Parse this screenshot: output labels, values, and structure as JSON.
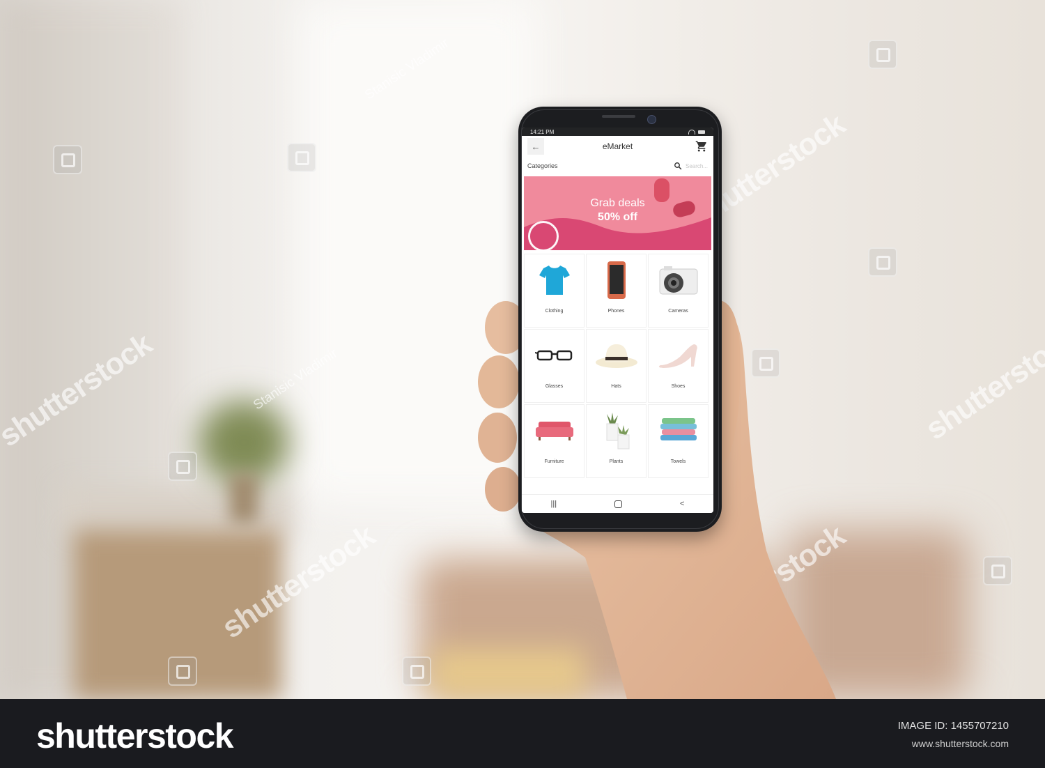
{
  "watermark": {
    "brand": "shutterstock",
    "author": "Stanisic Vladimir"
  },
  "phone": {
    "status": {
      "time": "14:21 PM"
    },
    "app": {
      "title": "eMarket",
      "categories_label": "Categories",
      "search_placeholder": "Search...",
      "banner": {
        "line1": "Grab deals",
        "line2": "50% off"
      },
      "categories": [
        {
          "label": "Clothing",
          "icon": "tshirt-icon"
        },
        {
          "label": "Phones",
          "icon": "smartphone-icon"
        },
        {
          "label": "Cameras",
          "icon": "camera-icon"
        },
        {
          "label": "Glasses",
          "icon": "glasses-icon"
        },
        {
          "label": "Hats",
          "icon": "hat-icon"
        },
        {
          "label": "Shoes",
          "icon": "shoe-icon"
        },
        {
          "label": "Furniture",
          "icon": "sofa-icon"
        },
        {
          "label": "Plants",
          "icon": "plant-icon"
        },
        {
          "label": "Towels",
          "icon": "towels-icon"
        }
      ],
      "nav": {
        "recent": "|||",
        "home": "",
        "back": "<"
      }
    }
  },
  "footer": {
    "brand": "shutterstock",
    "image_id": "IMAGE ID: 1455707210",
    "site": "www.shutterstock.com"
  },
  "colors": {
    "banner_pink": "#f08a9c",
    "banner_wave": "#d94873",
    "tshirt": "#1fa7d8",
    "sofa": "#e0566a",
    "footer_bg": "#1a1b1f"
  }
}
